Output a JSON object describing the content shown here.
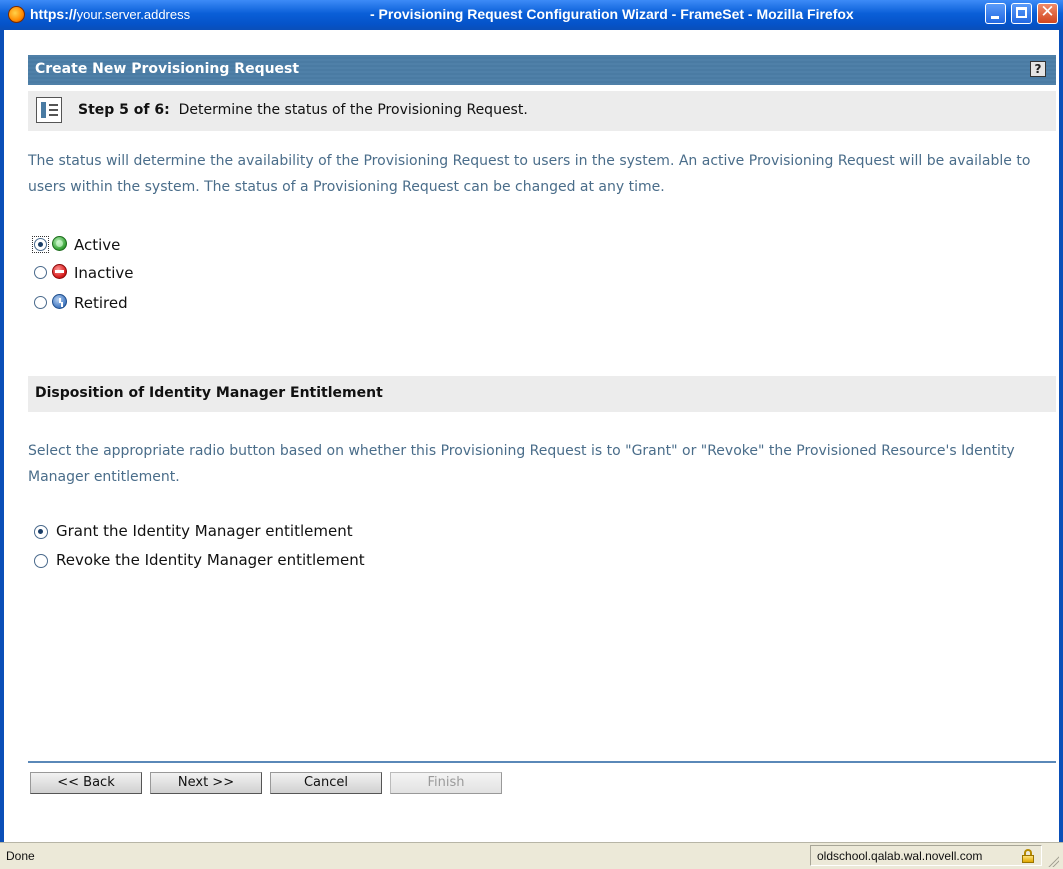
{
  "window": {
    "url_prefix": "https://",
    "url_host": "your.server.address",
    "title": "- Provisioning Request Configuration Wizard - FrameSet - Mozilla Firefox",
    "close_glyph": "✕"
  },
  "header": {
    "title": "Create New Provisioning Request",
    "help_label": "?"
  },
  "step": {
    "label": "Step 5 of 6:",
    "text": "Determine the status of the Provisioning Request."
  },
  "status_section": {
    "description": "The status will determine the availability of the Provisioning Request to users in the system.  An active Provisioning Request will be available to users within the system.  The status of a Provisioning Request can be changed at any time.",
    "options": [
      {
        "label": "Active",
        "icon": "active-status-icon",
        "selected": true
      },
      {
        "label": "Inactive",
        "icon": "inactive-status-icon",
        "selected": false
      },
      {
        "label": "Retired",
        "icon": "retired-status-icon",
        "selected": false
      }
    ]
  },
  "disposition_section": {
    "title": "Disposition of Identity Manager Entitlement",
    "description": "Select the appropriate radio button based on whether this Provisioning Request is to \"Grant\" or \"Revoke\" the Provisioned Resource's Identity Manager entitlement.",
    "options": [
      {
        "label": "Grant the Identity Manager entitlement",
        "selected": true
      },
      {
        "label": "Revoke the Identity Manager entitlement",
        "selected": false
      }
    ]
  },
  "buttons": {
    "back": "<< Back",
    "next": "Next >>",
    "cancel": "Cancel",
    "finish": "Finish"
  },
  "statusbar": {
    "left": "Done",
    "host": "oldschool.qalab.wal.novell.com"
  },
  "colors": {
    "header_bg": "#4d7ea6",
    "description_text": "#4a6d8a",
    "titlebar": "#0553c9"
  }
}
